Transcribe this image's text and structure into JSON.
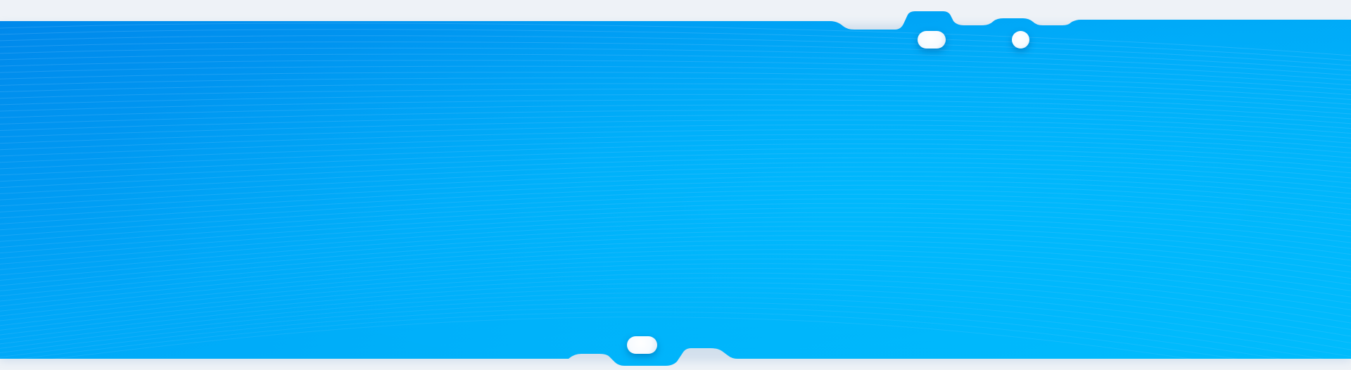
{
  "banner": {
    "gradient": [
      "#0088ea",
      "#00a6f7",
      "#00b8fb"
    ],
    "frame_color": "#eef2f7",
    "line_color": "#8fd2ff"
  },
  "pills": [
    {
      "name": "top-pill-wide"
    },
    {
      "name": "top-pill-round"
    },
    {
      "name": "bottom-pill-wide"
    }
  ]
}
